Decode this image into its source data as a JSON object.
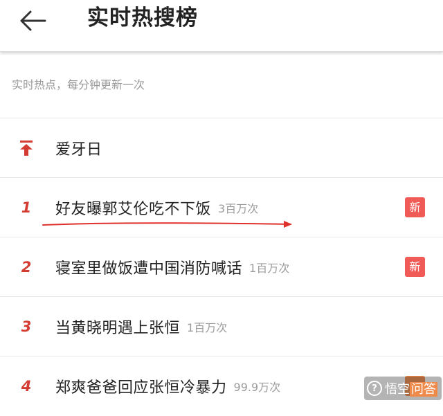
{
  "header": {
    "title": "实时热搜榜",
    "back_icon": "arrow-left-icon"
  },
  "subtitle": "实时热点，每分钟更新一次",
  "list": {
    "pinned": {
      "icon": "pin-to-top-icon",
      "title": "爱牙日",
      "count": ""
    },
    "items": [
      {
        "rank": "1",
        "title": "好友曝郭艾伦吃不下饭",
        "count": "3百万次",
        "badge": "新"
      },
      {
        "rank": "2",
        "title": "寝室里做饭遭中国消防喊话",
        "count": "1百万次",
        "badge": "新"
      },
      {
        "rank": "3",
        "title": "当黄晓明遇上张恒",
        "count": "1百万次",
        "badge": ""
      },
      {
        "rank": "4",
        "title": "郑爽爸爸回应张恒冷暴力",
        "count": "99.9万次",
        "badge": ""
      }
    ]
  },
  "watermark": {
    "text_a": "悟空",
    "text_b": "问答"
  },
  "colors": {
    "accent_red": "#d43c33",
    "badge_new": "#f05a57",
    "annotation_red": "#e0312c"
  }
}
